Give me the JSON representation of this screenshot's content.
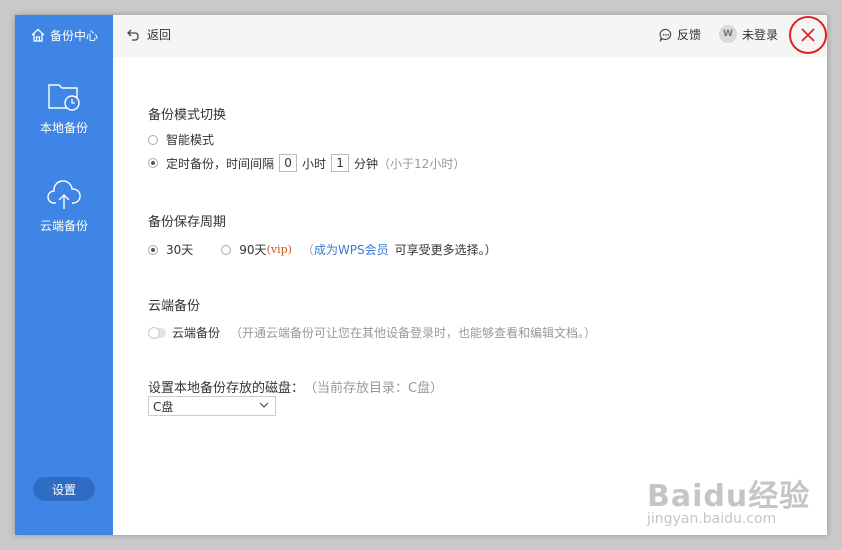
{
  "sidebar": {
    "title": "备份中心",
    "items": [
      {
        "label": "本地备份",
        "icon": "folder-clock-icon"
      },
      {
        "label": "云端备份",
        "icon": "cloud-upload-icon"
      }
    ],
    "settings_label": "设置"
  },
  "topbar": {
    "back_label": "返回",
    "feedback_label": "反馈",
    "login_label": "未登录",
    "avatar_text": "W"
  },
  "sections": {
    "mode": {
      "title": "备份模式切换",
      "smart_label": "智能模式",
      "timed_label": "定时备份，时间间隔",
      "hours_value": "0",
      "hours_unit": "小时",
      "minutes_value": "1",
      "minutes_unit": "分钟",
      "hint": "（小于12小时）"
    },
    "period": {
      "title": "备份保存周期",
      "opt30": "30天",
      "opt90": "90天",
      "vip_tag": "(vip)",
      "paren_open": "（",
      "link": "成为WPS会员",
      "tail": "可享受更多选择。）"
    },
    "cloud": {
      "title": "云端备份",
      "toggle_label": "云端备份",
      "hint": "（开通云端备份可让您在其他设备登录时，也能够查看和编辑文档。）"
    },
    "disk": {
      "title": "设置本地备份存放的磁盘：",
      "current": "（当前存放目录：C盘）",
      "selected": "C盘"
    }
  },
  "watermark": {
    "main": "Baidu经验",
    "sub": "jingyan.baidu.com"
  },
  "colors": {
    "sidebar": "#3e85e6",
    "accent_link": "#3a78d1",
    "close_ring": "#e21f1f"
  }
}
